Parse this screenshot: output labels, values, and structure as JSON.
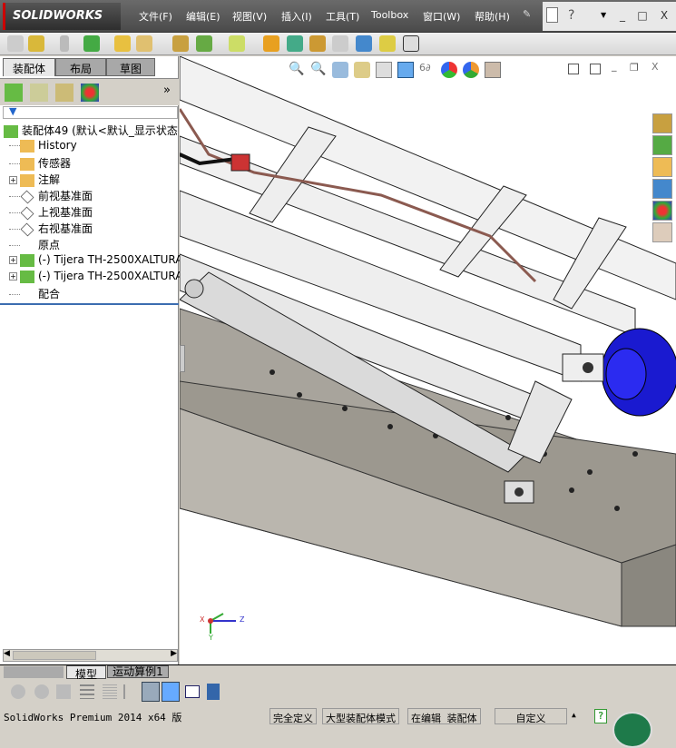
{
  "app": {
    "logo": "SOLIDWORKS"
  },
  "menu": [
    {
      "label": "文件(F)"
    },
    {
      "label": "编辑(E)"
    },
    {
      "label": "视图(V)"
    },
    {
      "label": "插入(I)"
    },
    {
      "label": "工具(T)"
    },
    {
      "label": "Toolbox"
    },
    {
      "label": "窗口(W)"
    },
    {
      "label": "帮助(H)"
    }
  ],
  "window_controls": {
    "minimize": "_",
    "restore": "□",
    "close": "X"
  },
  "left_panel": {
    "tabs": [
      {
        "label": "装配体"
      },
      {
        "label": "布局"
      },
      {
        "label": "草图"
      }
    ],
    "expand": "»",
    "tree": [
      {
        "label": "装配体49  (默认<默认_显示状态",
        "icon": "assembly-icon",
        "plus": false,
        "indent": 0
      },
      {
        "label": "History",
        "icon": "history-folder-icon",
        "plus": false,
        "indent": 1
      },
      {
        "label": "传感器",
        "icon": "sensor-folder-icon",
        "plus": false,
        "indent": 1
      },
      {
        "label": "注解",
        "icon": "annotation-folder-icon",
        "plus": true,
        "indent": 1
      },
      {
        "label": "前视基准面",
        "icon": "plane-icon",
        "plus": false,
        "indent": 1
      },
      {
        "label": "上视基准面",
        "icon": "plane-icon",
        "plus": false,
        "indent": 1
      },
      {
        "label": "右视基准面",
        "icon": "plane-icon",
        "plus": false,
        "indent": 1
      },
      {
        "label": "原点",
        "icon": "origin-icon",
        "plus": false,
        "indent": 1
      },
      {
        "label": "(-) Tijera TH-2500XALTURA-",
        "icon": "subassembly-icon",
        "plus": true,
        "indent": 1
      },
      {
        "label": "(-) Tijera TH-2500XALTURA_",
        "icon": "subassembly-icon",
        "plus": true,
        "indent": 1
      },
      {
        "label": "配合",
        "icon": "mates-icon",
        "plus": false,
        "indent": 1
      }
    ]
  },
  "bottom_tabs": [
    {
      "label": "模型"
    },
    {
      "label": "运动算例1"
    }
  ],
  "triad": {
    "x": "X",
    "y": "Y",
    "z": "Z"
  },
  "status": {
    "version": "SolidWorks Premium 2014 x64 版",
    "defined": "完全定义",
    "mode": "大型装配体模式",
    "editing": "在编辑 装配体",
    "units": "自定义",
    "help": "?"
  }
}
